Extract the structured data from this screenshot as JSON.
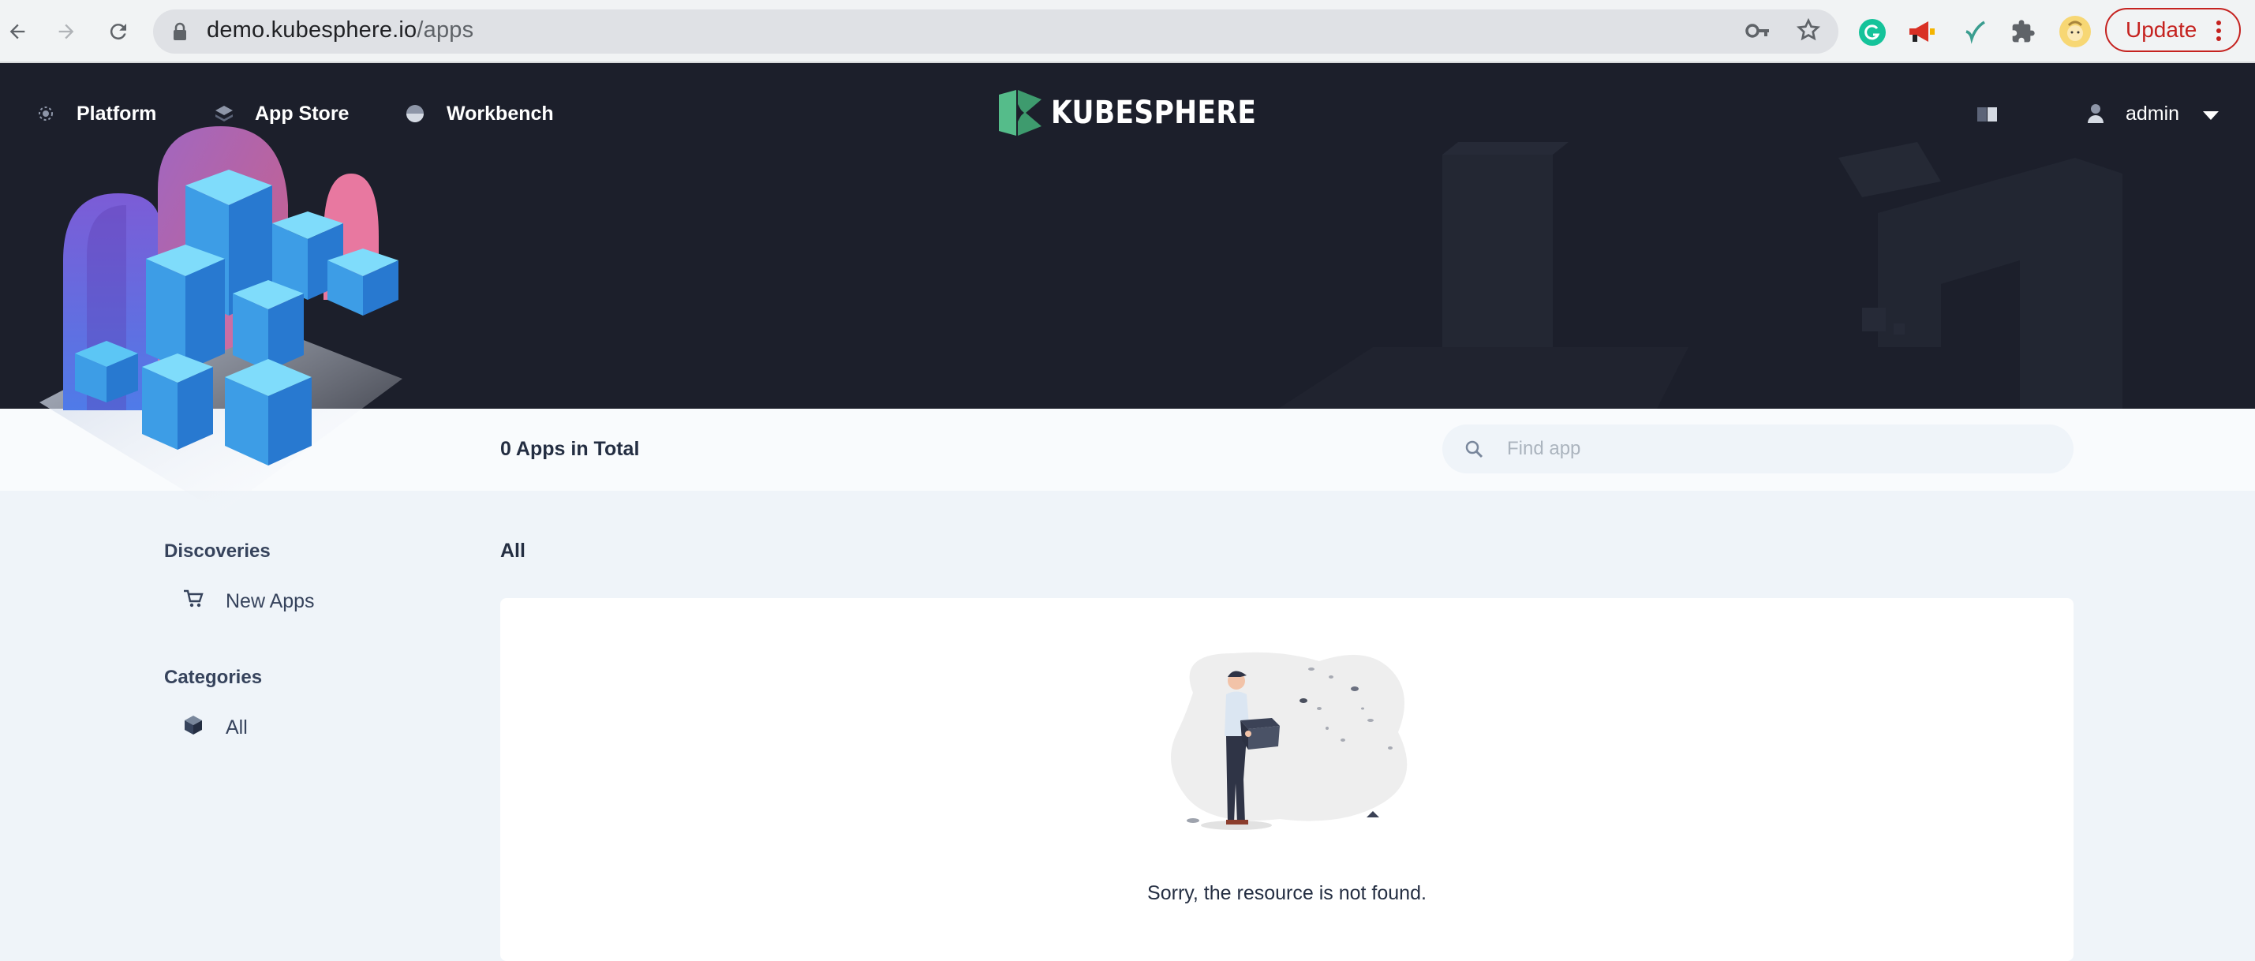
{
  "browser": {
    "url_host": "demo.kubesphere.io",
    "url_path": "/apps",
    "update_label": "Update",
    "icons": [
      "back-arrow-icon",
      "forward-arrow-icon",
      "reload-icon",
      "lock-icon",
      "key-icon",
      "star-icon",
      "grammarly-extension-icon",
      "megaphone-extension-icon",
      "check-extension-icon",
      "puzzle-extensions-icon",
      "profile-avatar-icon",
      "more-vert-icon"
    ]
  },
  "header": {
    "nav": [
      {
        "label": "Platform",
        "icon": "platform-icon"
      },
      {
        "label": "App Store",
        "icon": "app-store-icon"
      },
      {
        "label": "Workbench",
        "icon": "workbench-icon"
      }
    ],
    "logo_text": "KUBESPHERE",
    "user": "admin"
  },
  "toolbar": {
    "total_text": "0 Apps in Total",
    "search_placeholder": "Find app"
  },
  "sidebar": {
    "discoveries_heading": "Discoveries",
    "discoveries_items": [
      {
        "label": "New Apps",
        "icon": "cart-icon"
      }
    ],
    "categories_heading": "Categories",
    "categories_items": [
      {
        "label": "All",
        "icon": "cube-icon"
      }
    ]
  },
  "main": {
    "section_title": "All",
    "empty_message": "Sorry, the resource is not found."
  },
  "colors": {
    "header_bg": "#1c1f2b",
    "page_bg": "#eff4f9",
    "logo_green": "#55bc8a",
    "update_red": "#c5221f"
  }
}
